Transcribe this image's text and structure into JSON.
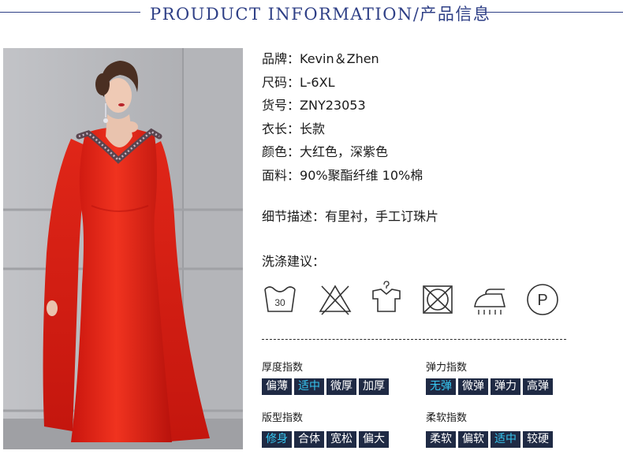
{
  "header": {
    "title": "PROUDUCT INFORMATION/产品信息"
  },
  "info": [
    {
      "key": "品牌：",
      "value": "Kevin＆Zhen"
    },
    {
      "key": "尺码：",
      "value": "L-6XL"
    },
    {
      "key": "货号：",
      "value": "ZNY23053"
    },
    {
      "key": "衣长：",
      "value": "长款"
    },
    {
      "key": "颜色：",
      "value": "大红色，深紫色"
    },
    {
      "key": "面料：",
      "value": "90%聚酯纤维 10%棉"
    }
  ],
  "detail": {
    "key": "细节描述：",
    "value": "有里衬，手工订珠片"
  },
  "care": {
    "title": "洗涤建议：",
    "icons": [
      "wash-30-icon",
      "do-not-bleach-icon",
      "hang-dry-icon",
      "do-not-tumble-dry-icon",
      "steam-iron-icon",
      "dry-clean-p-icon"
    ],
    "wash_temp": "30",
    "dry_clean_letter": "P"
  },
  "indices": [
    {
      "title": "厚度指数",
      "options": [
        "偏薄",
        "适中",
        "微厚",
        "加厚"
      ],
      "selected": 1
    },
    {
      "title": "弹力指数",
      "options": [
        "无弹",
        "微弹",
        "弹力",
        "高弹"
      ],
      "selected": 0
    },
    {
      "title": "版型指数",
      "options": [
        "修身",
        "合体",
        "宽松",
        "偏大"
      ],
      "selected": 0
    },
    {
      "title": "柔软指数",
      "options": [
        "柔软",
        "偏软",
        "适中",
        "较硬"
      ],
      "selected": 2
    }
  ],
  "colors": {
    "accent": "#2e3f86",
    "chip_bg": "#1f2a44",
    "chip_active": "#36c6f0",
    "dress": "#e8291c"
  }
}
